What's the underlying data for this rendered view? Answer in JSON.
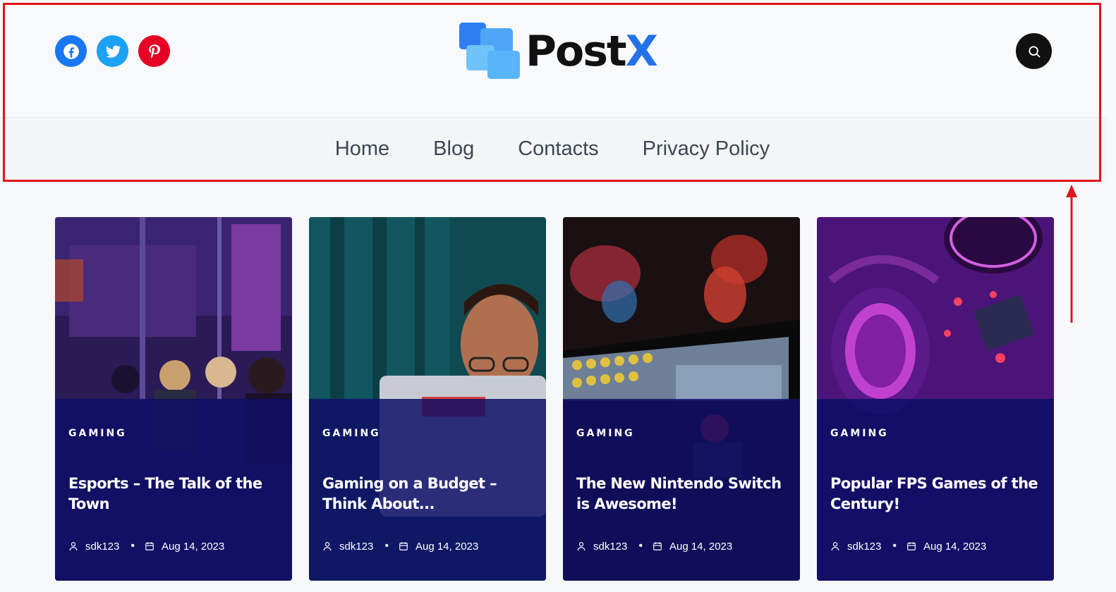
{
  "brand": {
    "name_main": "Post",
    "name_accent": "X",
    "accent_color": "#2472e8"
  },
  "socials": [
    {
      "name": "facebook-icon",
      "color": "#1877f2"
    },
    {
      "name": "twitter-icon",
      "color": "#1da1f2"
    },
    {
      "name": "pinterest-icon",
      "color": "#e60023"
    }
  ],
  "nav": {
    "items": [
      {
        "label": "Home"
      },
      {
        "label": "Blog"
      },
      {
        "label": "Contacts"
      },
      {
        "label": "Privacy Policy"
      }
    ]
  },
  "highlight_color": "#e0141e",
  "cards": [
    {
      "category": "GAMING",
      "title": "Esports – The Talk of the Town",
      "author": "sdk123",
      "date": "Aug 14, 2023",
      "image": "esports arena with gamers wearing headsets"
    },
    {
      "category": "GAMING",
      "title": "Gaming on a Budget – Think About...",
      "author": "sdk123",
      "date": "Aug 14, 2023",
      "image": "man behind laptop in teal lit room"
    },
    {
      "category": "GAMING",
      "title": "The New Nintendo Switch is Awesome!",
      "author": "sdk123",
      "date": "Aug 14, 2023",
      "image": "nintendo switch screen showing mario kart"
    },
    {
      "category": "GAMING",
      "title": "Popular FPS Games of the Century!",
      "author": "sdk123",
      "date": "Aug 14, 2023",
      "image": "gaming headset and mug under purple light"
    }
  ]
}
